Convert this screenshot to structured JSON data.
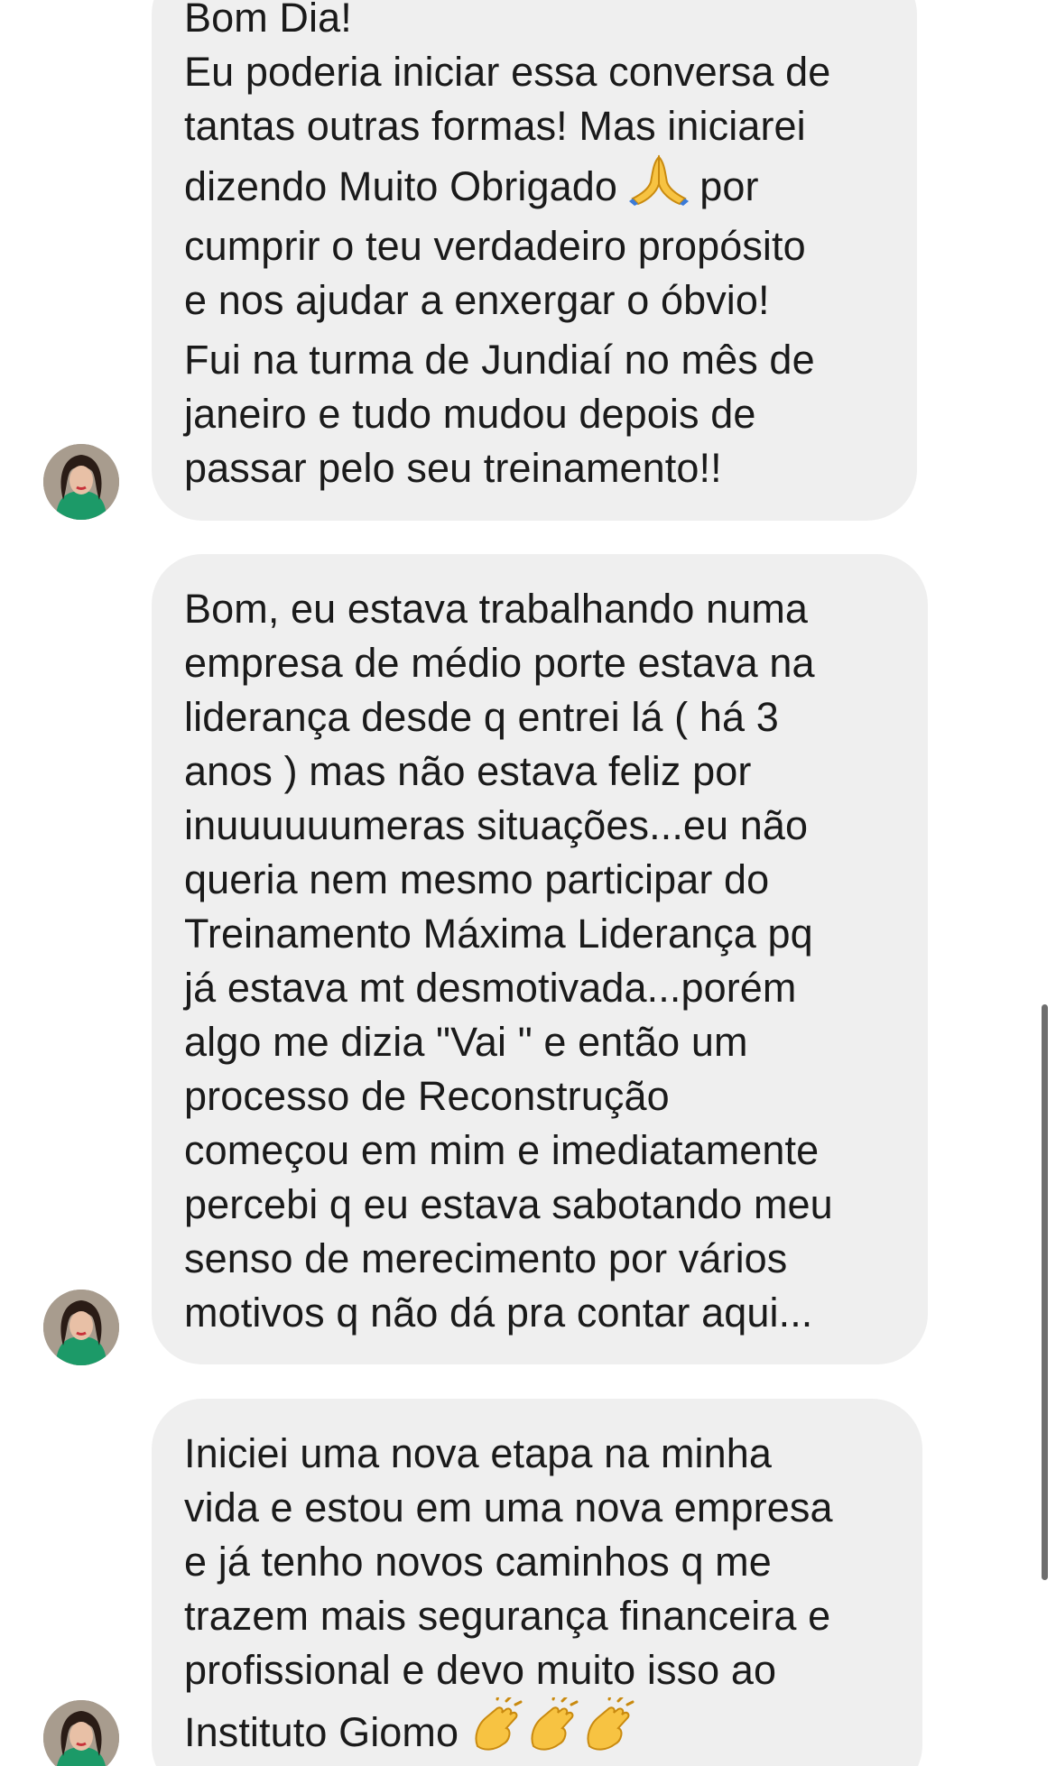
{
  "messages": [
    {
      "lines": [
        "Bom Dia!",
        "Eu poderia iniciar essa conversa de",
        "tantas outras formas! Mas iniciarei",
        "por",
        "cumprir o teu verdadeiro propósito",
        "e nos ajudar a enxergar o óbvio!",
        "Fui na turma de Jundiaí no mês de",
        "janeiro e tudo mudou depois de",
        "passar pelo seu treinamento!!"
      ],
      "line4_prefix": "dizendo Muito Obrigado",
      "emoji": "folded-hands-emoji"
    },
    {
      "lines": [
        "Bom, eu estava trabalhando numa",
        "empresa de médio porte estava na",
        "liderança desde q entrei lá ( há 3",
        "anos ) mas não estava feliz por",
        "inuuuuuumeras situações...eu não",
        "queria nem mesmo participar do",
        "Treinamento Máxima Liderança pq",
        "já estava mt desmotivada...porém",
        "algo me dizia \"Vai \" e então um",
        "processo de Reconstrução",
        "começou em mim e imediatamente",
        "percebi q eu estava sabotando meu",
        "senso de merecimento por vários",
        "motivos q não dá pra contar aqui..."
      ]
    },
    {
      "lines": [
        "Iniciei uma nova etapa na minha",
        "vida e estou em uma nova empresa",
        "e já tenho novos caminhos q me",
        "trazem mais segurança financeira e",
        "profissional e devo muito isso ao",
        "Instituto Giomo"
      ],
      "emoji": "clapping-hands-emoji",
      "emoji_count": 3
    }
  ],
  "colors": {
    "bubble": "#efefef",
    "text": "#1a1a1a",
    "background": "#ffffff",
    "scrollbar": "#6e6e6e"
  }
}
